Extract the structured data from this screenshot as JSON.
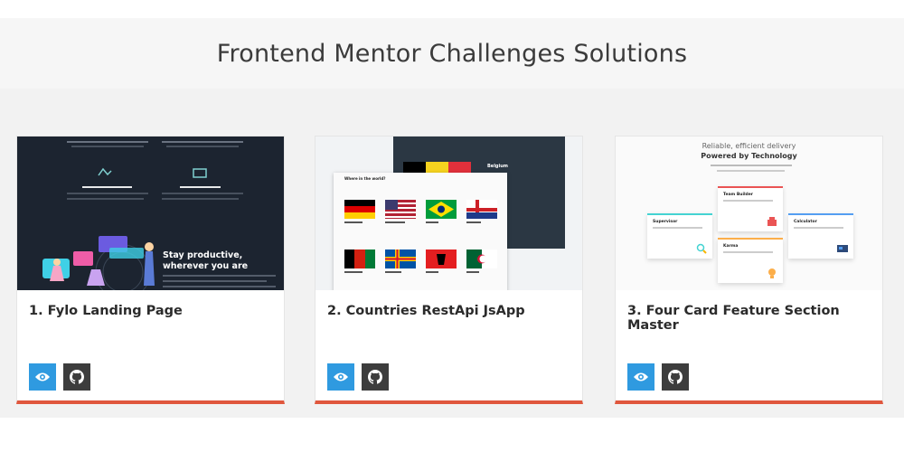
{
  "header": {
    "title": "Frontend Mentor Challenges Solutions"
  },
  "cards": [
    {
      "title": "1. Fylo Landing Page",
      "thumb_text": {
        "headline1": "Stay productive,",
        "headline2": "wherever you are"
      }
    },
    {
      "title": "2. Countries RestApi JsApp",
      "thumb_text": {
        "app_header": "Where in the world?",
        "detail_title": "Belgium"
      }
    },
    {
      "title": "3. Four Card Feature Section Master",
      "thumb_text": {
        "line1": "Reliable, efficient delivery",
        "line2": "Powered by Technology",
        "c1": "Supervisor",
        "c2": "Team Builder",
        "c3": "Karma",
        "c4": "Calculator"
      }
    }
  ],
  "colors": {
    "accent_border": "#e0573d",
    "preview_btn": "#2f9ae0",
    "code_btn": "#3d3d3d"
  },
  "icons": {
    "preview": "eye-icon",
    "code": "github-icon"
  }
}
